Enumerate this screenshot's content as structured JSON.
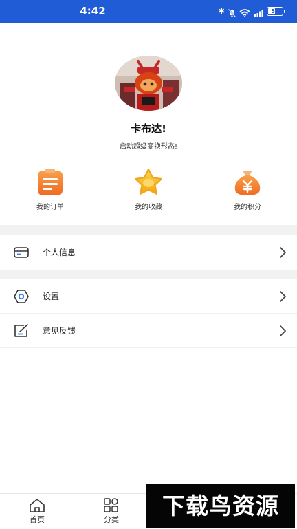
{
  "status_bar": {
    "time": "4:42",
    "battery": "50",
    "battery_level": 0.5,
    "icons": [
      "bluetooth-icon",
      "bell-muted-icon",
      "wifi-icon",
      "signal-icon",
      "battery-icon"
    ]
  },
  "profile": {
    "name": "卡布达!",
    "tagline": "启动超级变换形态!"
  },
  "quick_actions": [
    {
      "label": "我的订单",
      "icon": "order-icon"
    },
    {
      "label": "我的收藏",
      "icon": "star-icon"
    },
    {
      "label": "我的积分",
      "icon": "money-bag-icon"
    }
  ],
  "menu": [
    {
      "label": "个人信息",
      "icon": "card-icon"
    },
    {
      "label": "设置",
      "icon": "gear-icon"
    },
    {
      "label": "意见反馈",
      "icon": "edit-icon"
    }
  ],
  "bottom_nav": [
    {
      "label": "首页",
      "icon": "home-icon"
    },
    {
      "label": "分类",
      "icon": "grid-icon"
    }
  ],
  "watermark": "下载鸟资源",
  "colors": {
    "status_bar": "#1f5cd6",
    "accent_orange": "#f07a2c",
    "star": "#f5b51f"
  }
}
